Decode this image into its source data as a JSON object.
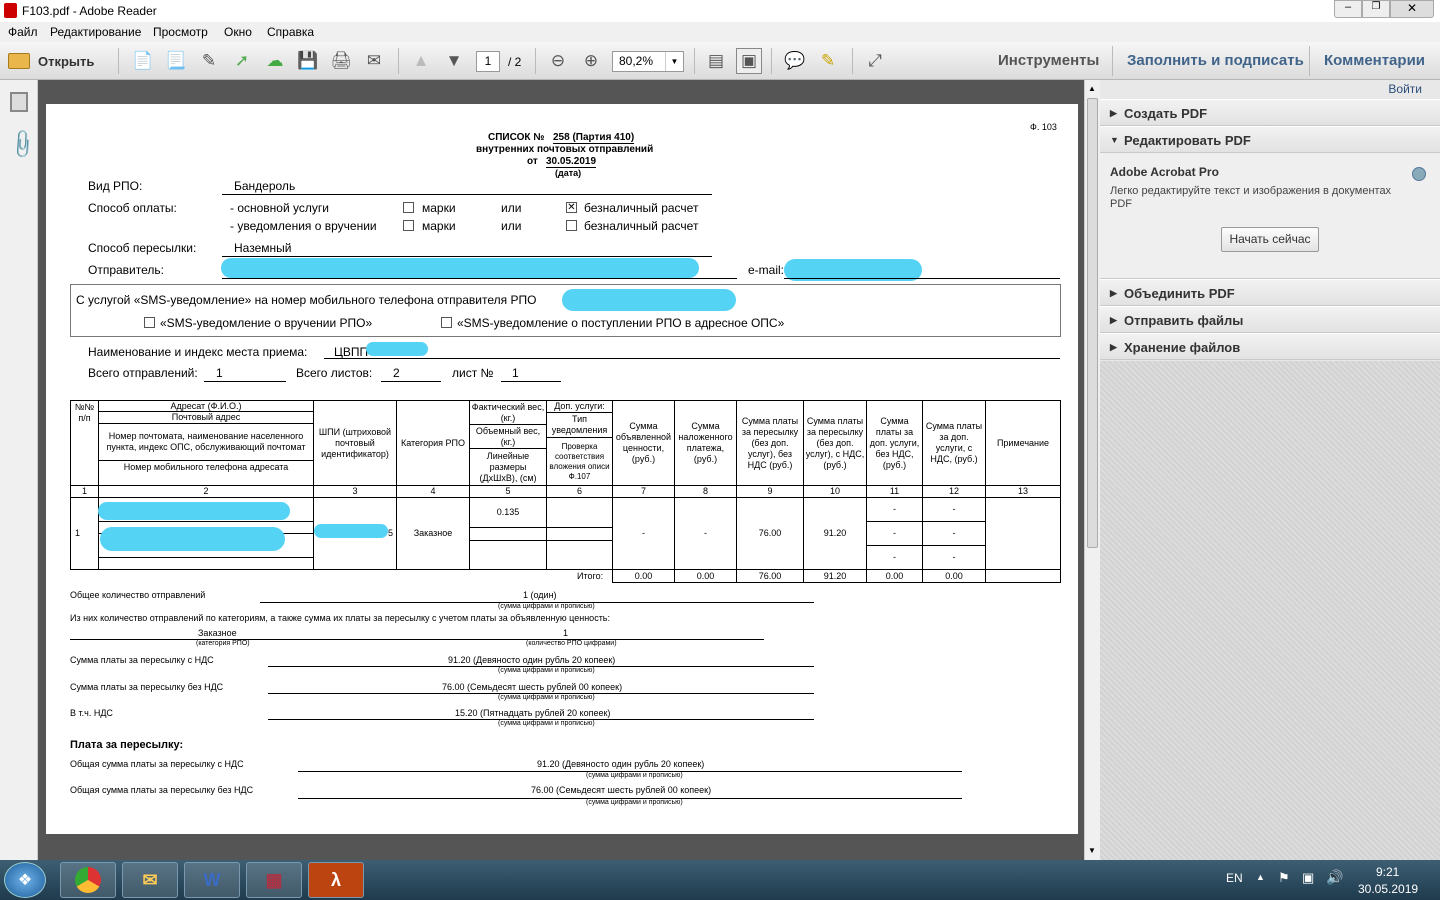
{
  "window": {
    "title": "F103.pdf - Adobe Reader"
  },
  "menu": [
    "Файл",
    "Редактирование",
    "Просмотр",
    "Окно",
    "Справка"
  ],
  "toolbar": {
    "open": "Открыть",
    "page_current": "1",
    "page_total": "/ 2",
    "zoom": "80,2%",
    "tabs": [
      "Инструменты",
      "Заполнить и подписать",
      "Комментарии"
    ]
  },
  "rpanel": {
    "login": "Войти",
    "sections_top": [
      "Создать PDF",
      "Редактировать PDF"
    ],
    "acrobat_title": "Adobe Acrobat Pro",
    "acrobat_desc_1": "Легко редактируйте текст и изображения в документах",
    "acrobat_desc_2": "PDF",
    "start_btn": "Начать сейчас",
    "sections_bottom": [
      "Объединить PDF",
      "Отправить файлы",
      "Хранение файлов"
    ]
  },
  "doc": {
    "form_code": "Ф. 103",
    "list_label": "СПИСОК №",
    "list_no": "258 (Партия 410)",
    "subtitle": "внутренних почтовых отправлений",
    "date_prefix": "от",
    "date": "30.05.2019",
    "date_caption": "(дата)",
    "rpo_type_label": "Вид РПО:",
    "rpo_type": "Бандероль",
    "payment_label": "Способ оплаты:",
    "pay1": "- основной услуги",
    "pay2": "- уведомления о вручении",
    "marks": "марки",
    "or": "или",
    "cashless": "безналичный расчет",
    "send_label": "Способ пересылки:",
    "send_value": "Наземный",
    "sender_label": "Отправитель:",
    "email_label": "e-mail:",
    "sms_text": "С услугой «SMS-уведомление» на номер мобильного телефона отправителя РПО",
    "sms1": "«SMS-уведомление о вручении РПО»",
    "sms2": "«SMS-уведомление о поступлении РПО в адресное ОПС»",
    "place_label": "Наименование и индекс места приема:",
    "place_value": "ЦВПП",
    "total_label": "Всего отправлений:",
    "total_value": "1",
    "sheets_label": "Всего листов:",
    "sheets_value": "2",
    "sheet_label": "лист №",
    "sheet_value": "1",
    "table": {
      "h_num": "№№ п/п",
      "h_addr": "Адресат (Ф.И.О.)",
      "h_addr2": "Почтовый адрес",
      "h_addr3": "Номер почтомата, наименование населенного пункта, индекс ОПС, обслуживающий почтомат",
      "h_addr4": "Номер мобильного телефона адресата",
      "h_shpi": "ШПИ (штриховой почтовый идентификатор)",
      "h_cat": "Категория РПО",
      "h_w1": "Фактический вес, (кг.)",
      "h_w2": "Объемный вес, (кг.)",
      "h_w3": "Линейные размеры (ДхШхВ), (см)",
      "h_s1": "Доп. услуги:",
      "h_s2": "Тип уведомления",
      "h_s3": "Проверка соответствия вложения описи Ф.107",
      "h_c7": "Сумма объявленной ценности, (руб.)",
      "h_c8": "Сумма наложенного платежа, (руб.)",
      "h_c9": "Сумма платы за пересылку (без доп. услуг), без НДС (руб.)",
      "h_c10": "Сумма платы за пересылку (без доп. услуг), с НДС, (руб.)",
      "h_c11": "Сумма платы за доп. услуги, без НДС, (руб.)",
      "h_c12": "Сумма платы за доп. услуги, с НДС, (руб.)",
      "h_c13": "Примечание",
      "nums": [
        "1",
        "2",
        "3",
        "4",
        "5",
        "6",
        "7",
        "8",
        "9",
        "10",
        "11",
        "12",
        "13"
      ],
      "row_no": "1",
      "row_shpi_tail": "5",
      "row_cat": "Заказное",
      "row_weight": "0.135",
      "row_c7": "-",
      "row_c8": "-",
      "row_c9": "76.00",
      "row_c10": "91.20",
      "row_c11": "-",
      "row_c12": "-",
      "itogo": "Итого:",
      "tot": [
        "0.00",
        "0.00",
        "76.00",
        "91.20",
        "0.00",
        "0.00"
      ]
    },
    "total_count_label": "Общее количество отправлений",
    "total_count": "1 (один)",
    "cap_sum": "(сумма цифрами и прописью)",
    "by_cat_label": "Из них количество отправлений по категориям, а также сумма их платы за пересылку с учетом платы за объявленную ценность:",
    "cat_name": "Заказное",
    "cat_caption": "(категория РПО)",
    "cat_count": "1",
    "cat_count_caption": "(количество РПО цифрами)",
    "s1_label": "Сумма платы за пересылку с НДС",
    "s1": "91.20 (Девяносто один рубль 20 копеек)",
    "s2_label": "Сумма платы за пересылку без НДС",
    "s2": "76.00 (Семьдесят шесть рублей 00 копеек)",
    "s3_label": "В т.ч. НДС",
    "s3": "15.20 (Пятнадцать рублей 20 копеек)",
    "fee_title": "Плата за пересылку:",
    "f1_label": "Общая сумма платы за пересылку с НДС",
    "f1": "91.20 (Девяносто один рубль 20 копеек)",
    "f2_label": "Общая сумма платы за пересылку без НДС",
    "f2": "76.00 (Семьдесят шесть рублей 00 копеек)",
    "cap_sum2": "(сумма цифрами и прописью)"
  },
  "tray": {
    "lang": "EN",
    "time": "9:21",
    "date": "30.05.2019"
  }
}
